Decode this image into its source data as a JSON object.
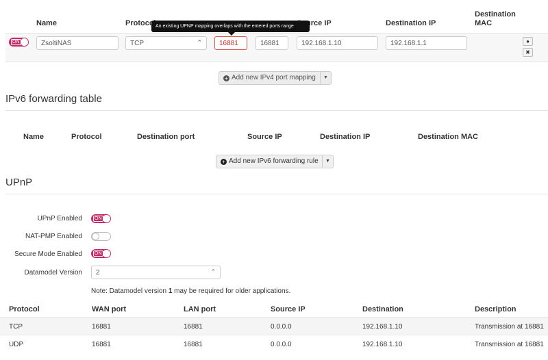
{
  "ipv4": {
    "headers": {
      "name": "Name",
      "protocol": "Protocol",
      "source_ip": "Source IP",
      "destination_ip": "Destination IP",
      "destination_mac": "Destination MAC"
    },
    "tooltip": "An existing UPNP mapping overlaps with the entered ports range",
    "row": {
      "enabled_label": "ON",
      "name": "ZsoltiNAS",
      "protocol": "TCP",
      "wan_port": "16881",
      "lan_port": "16881",
      "source_ip": "192.168.1.10",
      "destination_ip": "192.168.1.1"
    },
    "add_button": "Add new IPv4 port mapping"
  },
  "ipv6": {
    "title": "IPv6 forwarding table",
    "headers": {
      "name": "Name",
      "protocol": "Protocol",
      "destination_port": "Destination port",
      "source_ip": "Source IP",
      "destination_ip": "Destination IP",
      "destination_mac": "Destination MAC"
    },
    "add_button": "Add new IPv6 forwarding rule"
  },
  "upnp": {
    "title": "UPnP",
    "settings": {
      "upnp_enabled": {
        "label": "UPnP Enabled",
        "state": "ON"
      },
      "natpmp_enabled": {
        "label": "NAT-PMP Enabled",
        "state": ""
      },
      "secure_mode": {
        "label": "Secure Mode Enabled",
        "state": "ON"
      },
      "datamodel_version": {
        "label": "Datamodel Version",
        "value": "2"
      }
    },
    "note_prefix": "Note: Datamodel version ",
    "note_bold": "1",
    "note_suffix": " may be required for older applications.",
    "table": {
      "headers": [
        "Protocol",
        "WAN port",
        "LAN port",
        "Source IP",
        "Destination",
        "Description"
      ],
      "rows": [
        [
          "TCP",
          "16881",
          "16881",
          "0.0.0.0",
          "192.168.1.10",
          "Transmission at 16881"
        ],
        [
          "UDP",
          "16881",
          "16881",
          "0.0.0.0",
          "192.168.1.10",
          "Transmission at 16881"
        ]
      ]
    }
  },
  "colors": {
    "accent": "#c52968",
    "error": "#d9534f"
  }
}
